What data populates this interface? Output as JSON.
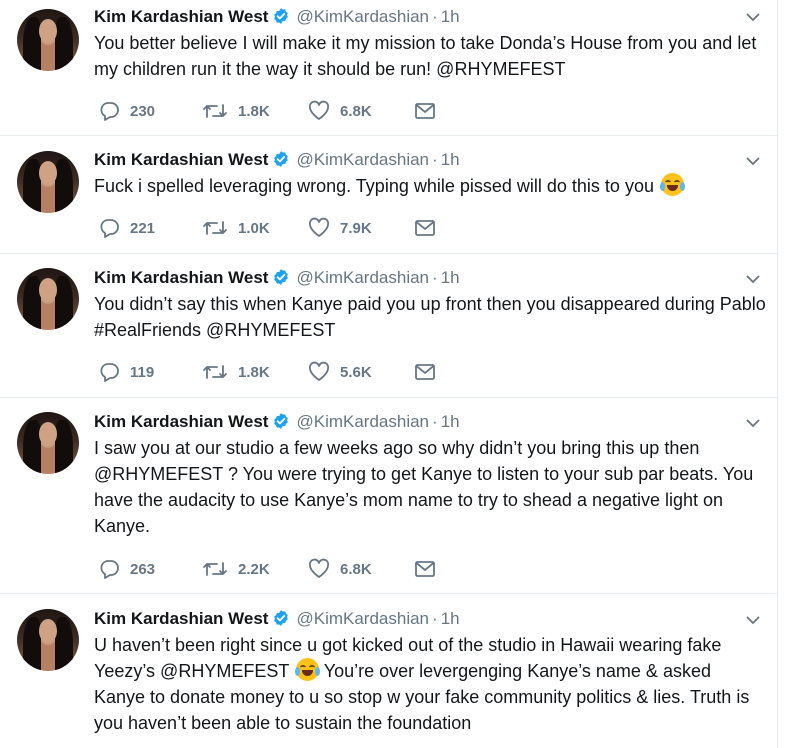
{
  "tweets": [
    {
      "name": "Kim Kardashian West",
      "handle": "@KimKardashian",
      "separator": "·",
      "time": "1h",
      "text": "You better believe I will make it my mission to take Donda’s House from you and let my children run it the way it should be run! @RHYMEFEST",
      "replies": "230",
      "retweets": "1.8K",
      "likes": "6.8K"
    },
    {
      "name": "Kim Kardashian West",
      "handle": "@KimKardashian",
      "separator": "·",
      "time": "1h",
      "text": "Fuck i spelled leveraging wrong. Typing while pissed will do this to you",
      "emoji_icon": "face-with-tears-of-joy-icon",
      "replies": "221",
      "retweets": "1.0K",
      "likes": "7.9K"
    },
    {
      "name": "Kim Kardashian West",
      "handle": "@KimKardashian",
      "separator": "·",
      "time": "1h",
      "text": "You didn’t say this when Kanye paid you up front then you disappeared during Pablo #RealFriends @RHYMEFEST",
      "replies": "119",
      "retweets": "1.8K",
      "likes": "5.6K"
    },
    {
      "name": "Kim Kardashian West",
      "handle": "@KimKardashian",
      "separator": "·",
      "time": "1h",
      "text": "I saw you at our studio a few weeks ago so why didn’t you bring this up then @RHYMEFEST ? You were trying to get Kanye to listen to your sub par beats. You have the audacity to use Kanye’s mom name to try to shead a negative light on Kanye.",
      "replies": "263",
      "retweets": "2.2K",
      "likes": "6.8K"
    },
    {
      "name": "Kim Kardashian West",
      "handle": "@KimKardashian",
      "separator": "·",
      "time": "1h",
      "text_before": "U haven’t been right since u got kicked out of the studio in Hawaii wearing fake Yeezy’s @RHYMEFEST",
      "text_after": "You’re over levergenging Kanye’s name & asked Kanye to donate money to u so stop w your fake community politics & lies. Truth is you haven’t been able to sustain the foundation",
      "emoji_icon": "face-with-tears-of-joy-icon"
    }
  ],
  "colors": {
    "text": "#14171a",
    "secondary": "#657786",
    "verified": "#1da1f2",
    "divider": "#e6ecf0"
  },
  "icons": {
    "verified": "verified-badge-icon",
    "caret": "chevron-down-icon",
    "reply": "reply-icon",
    "retweet": "retweet-icon",
    "like": "heart-icon",
    "dm": "envelope-icon"
  }
}
